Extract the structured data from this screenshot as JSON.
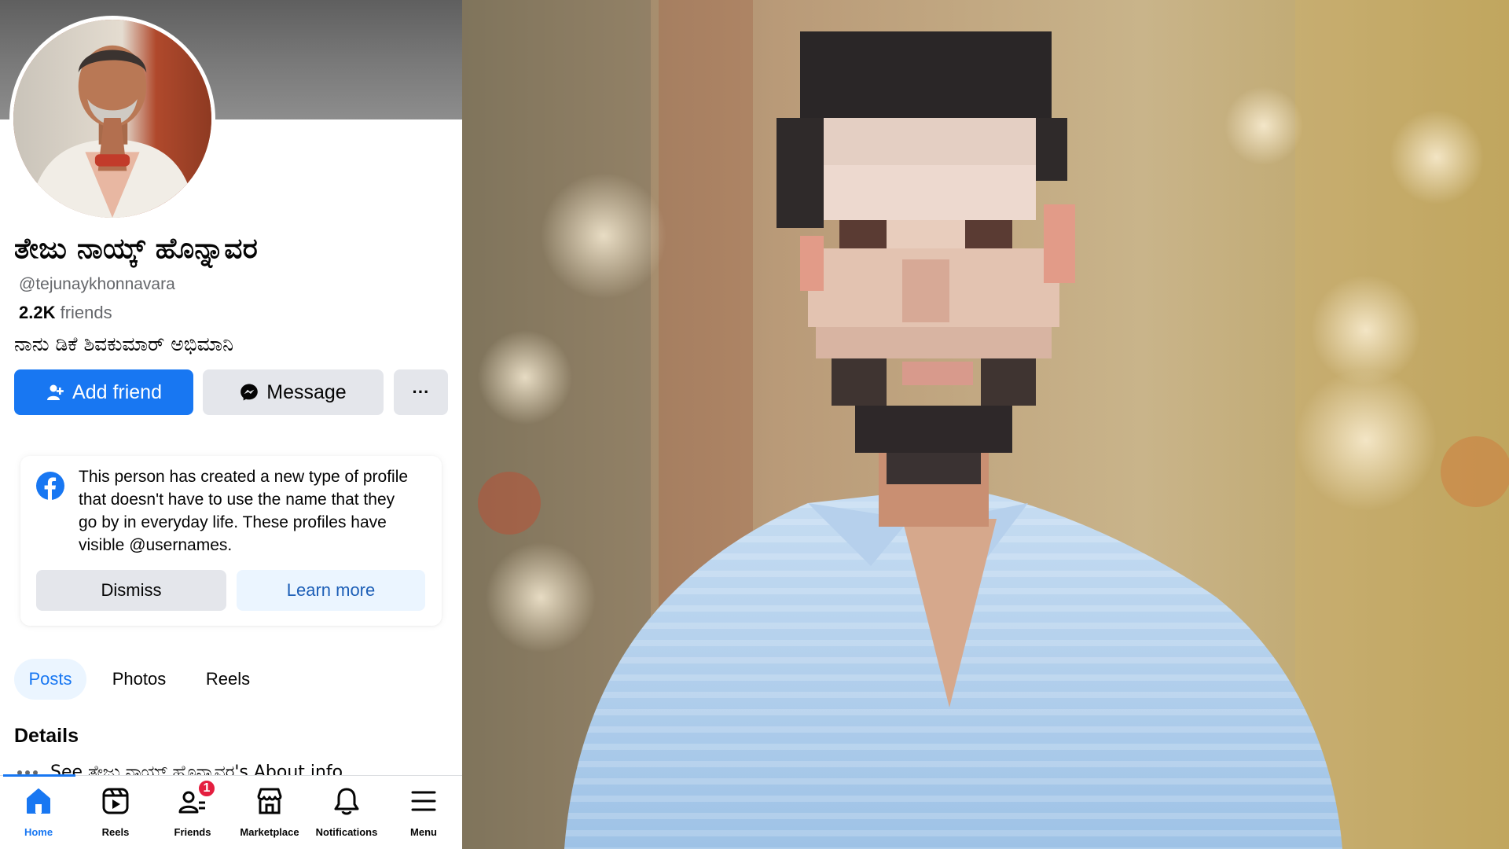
{
  "profile": {
    "name": "ತೇಜು ನಾಯ್ಕ್ ಹೊನ್ನಾವರ",
    "username": "@tejunaykhonnavara",
    "friends_count": "2.2K",
    "friends_label": "friends",
    "bio": "ನಾನು ಡಿಕೆ ಶಿವಕುಮಾರ್ ಅಭಿಮಾನಿ",
    "avatar_icon": "profile-photo-man-folded-hands"
  },
  "actions": {
    "add_friend": "Add friend",
    "message": "Message",
    "more": "···"
  },
  "notice": {
    "text": "This person has created a new type of profile that doesn't have to use the name that they go by in everyday life. These profiles have visible @usernames.",
    "dismiss": "Dismiss",
    "learn_more": "Learn more",
    "icon": "facebook-logo"
  },
  "tabs": [
    {
      "label": "Posts",
      "active": true
    },
    {
      "label": "Photos",
      "active": false
    },
    {
      "label": "Reels",
      "active": false
    }
  ],
  "details": {
    "title": "Details",
    "about_link": "See ತೇಜು ನಾಯ್ಕ್ ಹೊನ್ನಾವರ's About info"
  },
  "bottom_nav": [
    {
      "label": "Home",
      "icon": "home-icon",
      "active": true
    },
    {
      "label": "Reels",
      "icon": "reels-icon",
      "active": false
    },
    {
      "label": "Friends",
      "icon": "friends-icon",
      "active": false,
      "badge": "1"
    },
    {
      "label": "Marketplace",
      "icon": "marketplace-icon",
      "active": false
    },
    {
      "label": "Notifications",
      "icon": "bell-icon",
      "active": false
    },
    {
      "label": "Menu",
      "icon": "menu-icon",
      "active": false
    }
  ],
  "photo": {
    "subject": "pixelated-face-man-blue-striped-shirt"
  },
  "colors": {
    "fb_blue": "#1877f2",
    "button_gray": "#e4e6eb",
    "badge_red": "#e41e3f",
    "secondary_text": "#65676b"
  }
}
